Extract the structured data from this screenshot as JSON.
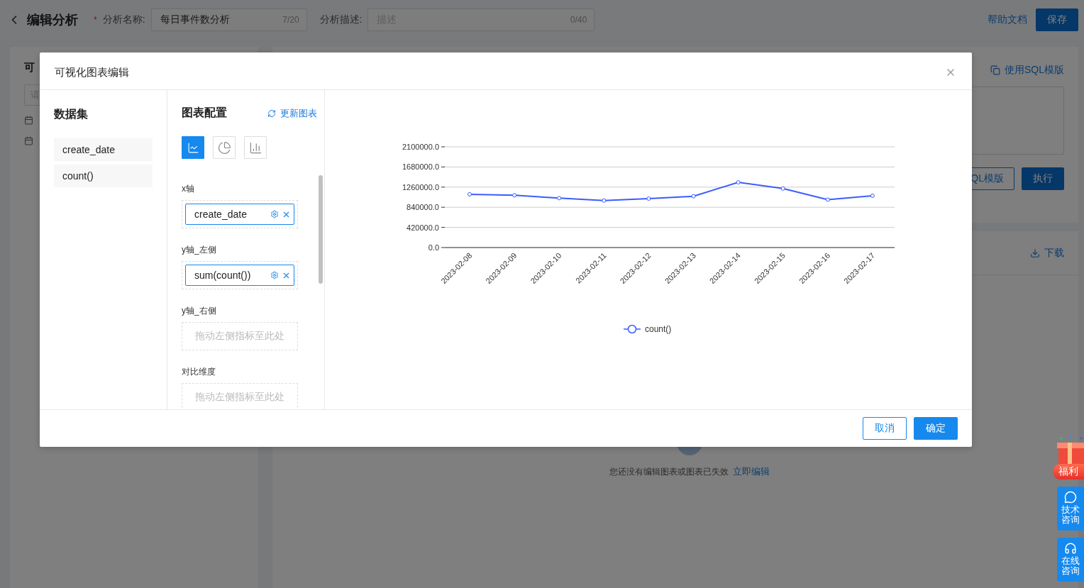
{
  "header": {
    "title": "编辑分析",
    "name_field": {
      "required_mark": "*",
      "label": "分析名称:",
      "value": "每日事件数分析",
      "counter": "7/20"
    },
    "desc_field": {
      "label": "分析描述:",
      "placeholder": "描述",
      "counter": "0/40"
    },
    "help_link": "帮助文档",
    "save_button": "保存"
  },
  "left_panel": {
    "title": "可",
    "search": {
      "placeholder": "请"
    }
  },
  "sql_panel": {
    "template_link": "使用SQL模版",
    "template_button": "QL模版",
    "run_button": "执行"
  },
  "result_panel": {
    "download": "下载",
    "empty_text": "您还没有编辑图表或图表已失效",
    "edit_link": "立即编辑"
  },
  "modal": {
    "title": "可视化图表编辑",
    "dataset": {
      "title": "数据集",
      "fields": [
        "create_date",
        "count()"
      ]
    },
    "config": {
      "title": "图表配置",
      "refresh": "更新图表",
      "chart_types": [
        {
          "kind": "line",
          "selected": true
        },
        {
          "kind": "pie",
          "selected": false
        },
        {
          "kind": "bar",
          "selected": false
        }
      ],
      "slots": [
        {
          "label": "x轴",
          "kind": "filled",
          "value": "create_date"
        },
        {
          "label": "y轴_左侧",
          "kind": "filled",
          "value": "sum(count())"
        },
        {
          "label": "y轴_右侧",
          "kind": "empty",
          "placeholder": "拖动左侧指标至此处"
        },
        {
          "label": "对比维度",
          "kind": "empty",
          "placeholder": "拖动左侧指标至此处"
        }
      ]
    },
    "chart_data": {
      "type": "line",
      "categories": [
        "2023-02-08",
        "2023-02-09",
        "2023-02-10",
        "2023-02-11",
        "2023-02-12",
        "2023-02-13",
        "2023-02-14",
        "2023-02-15",
        "2023-02-16",
        "2023-02-17"
      ],
      "series": [
        {
          "name": "count()",
          "color": "#3a5cff",
          "marker": true,
          "values": [
            1110000,
            1090000,
            1030000,
            980000,
            1020000,
            1070000,
            1360000,
            1230000,
            1000000,
            1080000
          ]
        }
      ],
      "grid": true,
      "ylim": [
        0,
        2100000
      ],
      "yticks": [
        {
          "value": 0,
          "label": "0.0"
        },
        {
          "value": 420000,
          "label": "420000.0"
        },
        {
          "value": 840000,
          "label": "840000.0"
        },
        {
          "value": 1260000,
          "label": "1260000.0"
        },
        {
          "value": 1680000,
          "label": "1680000.0"
        },
        {
          "value": 2100000,
          "label": "2100000.0"
        }
      ]
    },
    "buttons": {
      "cancel": "取消",
      "ok": "确定"
    }
  },
  "floating": [
    {
      "kind": "gift",
      "label": "福利"
    },
    {
      "kind": "chat",
      "label": "技术咨询"
    },
    {
      "kind": "headset",
      "label": "在线咨询"
    }
  ]
}
